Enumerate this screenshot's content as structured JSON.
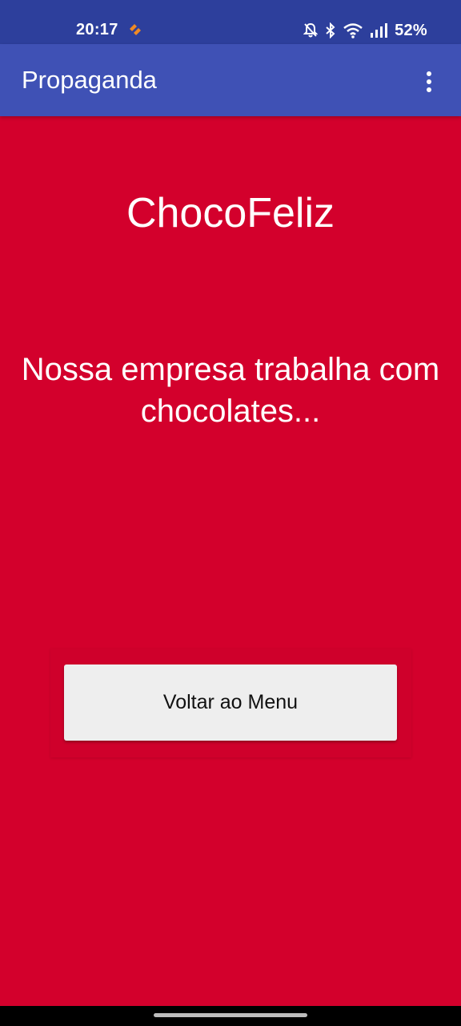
{
  "status_bar": {
    "time": "20:17",
    "battery": "52%",
    "icons": [
      "app-notification-icon",
      "mute-icon",
      "bluetooth-icon",
      "wifi-icon",
      "signal-icon"
    ]
  },
  "app_bar": {
    "title": "Propaganda",
    "menu_icon": "more-vert-icon"
  },
  "content": {
    "brand_title": "ChocoFeliz",
    "tagline": "Nossa empresa trabalha com chocolates...",
    "back_button_label": "Voltar ao Menu"
  },
  "colors": {
    "status_bar": "#2d3f9c",
    "app_bar": "#3f51b5",
    "background": "#d3002c",
    "button": "#eeeeee"
  }
}
